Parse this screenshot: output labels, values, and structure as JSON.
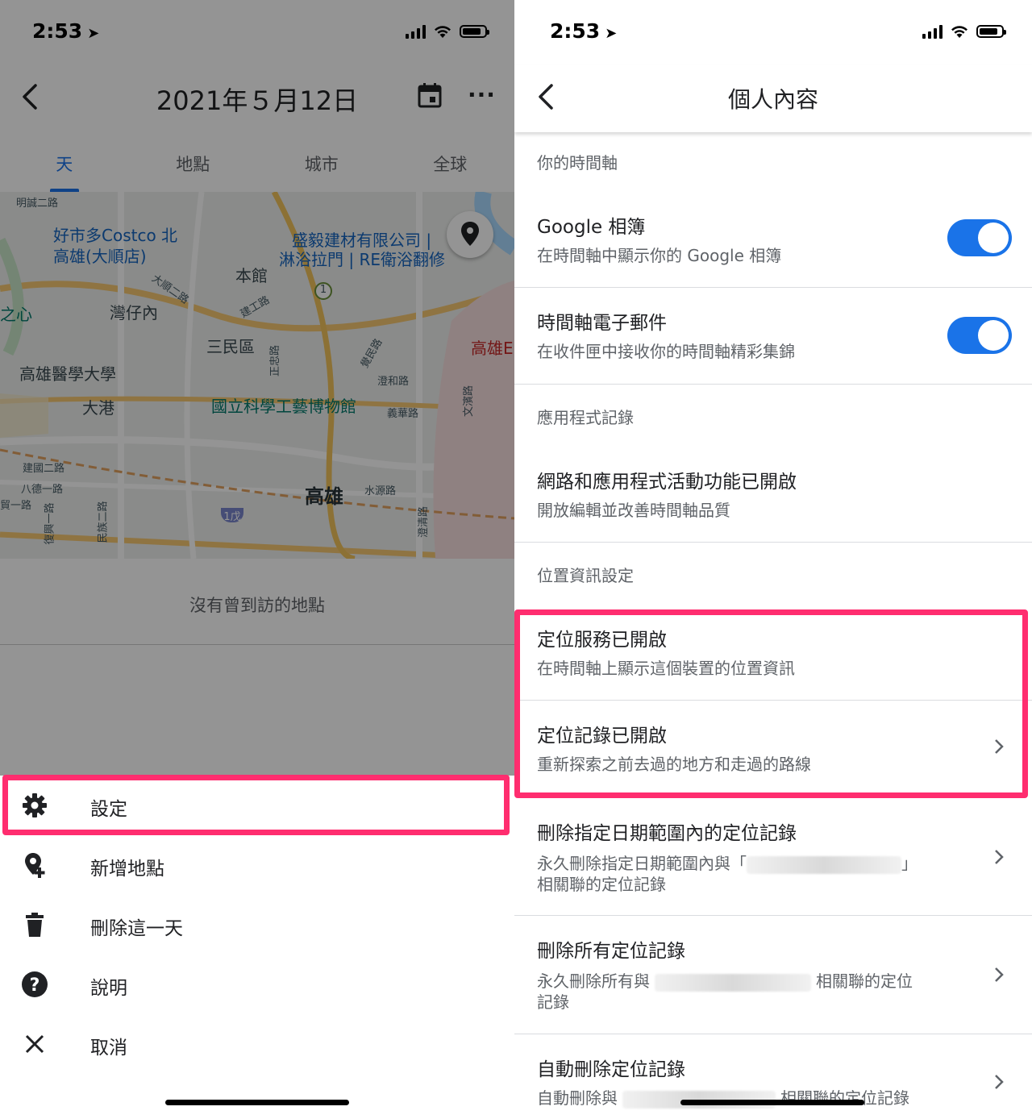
{
  "status_left": {
    "time": "2:53"
  },
  "status_right": {
    "time": "2:53"
  },
  "timeline": {
    "date_title": "2021年５月12日",
    "tabs": [
      {
        "label": "天",
        "active": true
      },
      {
        "label": "地點",
        "active": false
      },
      {
        "label": "城市",
        "active": false
      },
      {
        "label": "全球",
        "active": false
      }
    ],
    "map_labels": {
      "costco": "好市多Costco 北",
      "costco2": "高雄(大順店)",
      "store": "盛毅建材有限公司 |",
      "store2": "淋浴拉門 | RE衛浴翻修",
      "benguan": "本館",
      "wanzainei": "灣仔內",
      "sanmin": "三民區",
      "kmu": "高雄醫學大學",
      "dagang": "大港",
      "museum": "國立科學工藝博物館",
      "kaohsiung": "高雄",
      "kaohsiung_red": "高雄E",
      "heart": "之心",
      "road1": "明誠二路",
      "road2": "建國二路",
      "road3": "八德一路",
      "road4": "水源路",
      "road5": "大順二路",
      "road6": "建工路",
      "road7": "澄和路",
      "road8": "義華路",
      "road9": "澄清路",
      "road10": "民族二路",
      "road11": "復興一路",
      "road12": "文濱路",
      "road13": "覺民路",
      "road14": "正忠路",
      "road15": "貿一路",
      "highway": "1",
      "highway2": "1戊"
    },
    "no_places": "沒有曾到訪的地點"
  },
  "menu": [
    {
      "label": "設定",
      "icon": "gear-icon",
      "name": "menu-settings"
    },
    {
      "label": "新增地點",
      "icon": "add-place-icon",
      "name": "menu-add-place"
    },
    {
      "label": "刪除這一天",
      "icon": "trash-icon",
      "name": "menu-delete-day"
    },
    {
      "label": "說明",
      "icon": "help-icon",
      "name": "menu-help"
    },
    {
      "label": "取消",
      "icon": "close-icon",
      "name": "menu-cancel"
    }
  ],
  "settings": {
    "title": "個人內容",
    "section_timeline": "你的時間軸",
    "google_photos": {
      "title": "Google 相簿",
      "desc": "在時間軸中顯示你的 Google 相簿",
      "on": true
    },
    "timeline_email": {
      "title": "時間軸電子郵件",
      "desc": "在收件匣中接收你的時間軸精彩集錦",
      "on": true
    },
    "section_app": "應用程式記錄",
    "web_app": {
      "title": "網路和應用程式活動功能已開啟",
      "desc": "開放編輯並改善時間軸品質"
    },
    "section_location": "位置資訊設定",
    "location_services": {
      "title": "定位服務已開啟",
      "desc": "在時間軸上顯示這個裝置的位置資訊"
    },
    "location_history": {
      "title": "定位記錄已開啟",
      "desc": "重新探索之前去過的地方和走過的路線"
    },
    "delete_range": {
      "title": "刪除指定日期範圍內的定位記錄",
      "desc_a": "永久刪除指定日期範圍內與「",
      "desc_b": "」",
      "desc_c": "相關聯的定位記錄"
    },
    "delete_all": {
      "title": "刪除所有定位記錄",
      "desc_a": "永久刪除所有與",
      "desc_b": "相關聯的定位",
      "desc_c": "記錄"
    },
    "auto_delete": {
      "title": "自動刪除定位記錄",
      "desc_a": "自動刪除與",
      "desc_b": "相關聯的定位記錄"
    }
  }
}
